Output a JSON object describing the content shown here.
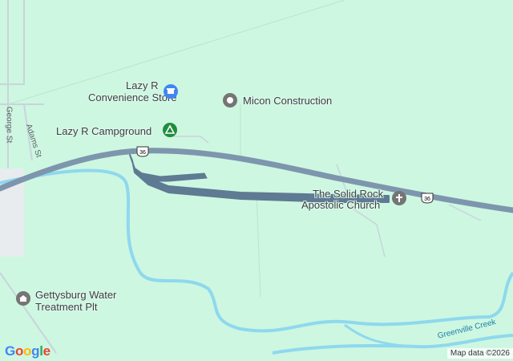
{
  "pois": {
    "convenience": {
      "label_line1": "Lazy R",
      "label_line2": "Convenience Store",
      "icon": "shopping-cart-icon",
      "color": "#4285f4"
    },
    "micon": {
      "label": "Micon Construction",
      "icon": "pin-icon",
      "color": "#757575"
    },
    "campground": {
      "label": "Lazy R Campground",
      "icon": "tent-icon",
      "color": "#1e8e3e"
    },
    "church": {
      "label_line1": "The Solid Rock",
      "label_line2": "Apostolic Church",
      "icon": "cross-icon",
      "color": "#757575"
    },
    "water": {
      "label_line1": "Gettysburg Water",
      "label_line2": "Treatment Plt",
      "icon": "facility-icon",
      "color": "#757575"
    }
  },
  "streets": {
    "george": "George St",
    "adams": "Adams St"
  },
  "route_shields": [
    "36",
    "36"
  ],
  "creek_label": "Greenville Creek",
  "logo": [
    "G",
    "o",
    "o",
    "g",
    "l",
    "e"
  ],
  "attribution": "Map data ©2026",
  "colors": {
    "land": "#cdf7e1",
    "water": "#8fd8ee",
    "highway": "#7d96ad",
    "highlight": "#5f7a93"
  }
}
